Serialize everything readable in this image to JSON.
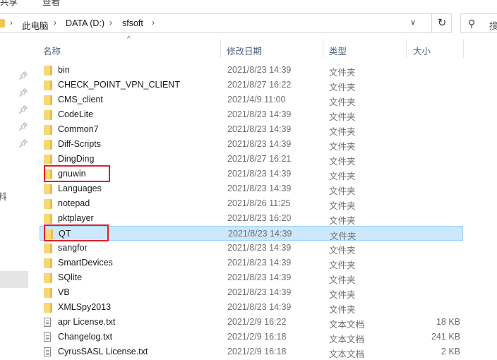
{
  "ribbon": {
    "tabs": [
      "共享",
      "查看"
    ]
  },
  "addressbar": {
    "crumbs": [
      "此电脑",
      "DATA (D:)",
      "sfsoft"
    ],
    "search_placeholder": "搜"
  },
  "nav": {
    "partial_label": "料"
  },
  "columns": {
    "name": "名称",
    "modified": "修改日期",
    "type": "类型",
    "size": "大小"
  },
  "files": [
    {
      "name": "bin",
      "modified": "2021/8/23 14:39",
      "type": "文件夹",
      "size": "",
      "icon": "folder-icon"
    },
    {
      "name": "CHECK_POINT_VPN_CLIENT",
      "modified": "2021/8/27 16:22",
      "type": "文件夹",
      "size": "",
      "icon": "folder-icon"
    },
    {
      "name": "CMS_client",
      "modified": "2021/4/9 11:00",
      "type": "文件夹",
      "size": "",
      "icon": "folder-icon"
    },
    {
      "name": "CodeLite",
      "modified": "2021/8/23 14:39",
      "type": "文件夹",
      "size": "",
      "icon": "folder-icon"
    },
    {
      "name": "Common7",
      "modified": "2021/8/23 14:39",
      "type": "文件夹",
      "size": "",
      "icon": "folder-icon"
    },
    {
      "name": "Diff-Scripts",
      "modified": "2021/8/23 14:39",
      "type": "文件夹",
      "size": "",
      "icon": "folder-icon"
    },
    {
      "name": "DingDing",
      "modified": "2021/8/27 16:21",
      "type": "文件夹",
      "size": "",
      "icon": "folder-icon"
    },
    {
      "name": "gnuwin",
      "modified": "2021/8/23 14:39",
      "type": "文件夹",
      "size": "",
      "icon": "folder-icon",
      "highlight": true
    },
    {
      "name": "Languages",
      "modified": "2021/8/23 14:39",
      "type": "文件夹",
      "size": "",
      "icon": "folder-icon"
    },
    {
      "name": "notepad",
      "modified": "2021/8/26 11:25",
      "type": "文件夹",
      "size": "",
      "icon": "folder-icon"
    },
    {
      "name": "pktplayer",
      "modified": "2021/8/23 16:20",
      "type": "文件夹",
      "size": "",
      "icon": "folder-icon"
    },
    {
      "name": "QT",
      "modified": "2021/8/23 14:39",
      "type": "文件夹",
      "size": "",
      "icon": "folder-icon",
      "selected": true,
      "highlight": true
    },
    {
      "name": "sangfor",
      "modified": "2021/8/23 14:39",
      "type": "文件夹",
      "size": "",
      "icon": "folder-icon"
    },
    {
      "name": "SmartDevices",
      "modified": "2021/8/23 14:39",
      "type": "文件夹",
      "size": "",
      "icon": "folder-icon"
    },
    {
      "name": "SQlite",
      "modified": "2021/8/23 14:39",
      "type": "文件夹",
      "size": "",
      "icon": "folder-icon"
    },
    {
      "name": "VB",
      "modified": "2021/8/23 14:39",
      "type": "文件夹",
      "size": "",
      "icon": "folder-icon"
    },
    {
      "name": "XMLSpy2013",
      "modified": "2021/8/23 14:39",
      "type": "文件夹",
      "size": "",
      "icon": "folder-icon"
    },
    {
      "name": "apr License.txt",
      "modified": "2021/2/9 16:22",
      "type": "文本文档",
      "size": "18 KB",
      "icon": "text-file-icon"
    },
    {
      "name": "Changelog.txt",
      "modified": "2021/2/9 16:18",
      "type": "文本文档",
      "size": "241 KB",
      "icon": "text-file-icon"
    },
    {
      "name": "CyrusSASL License.txt",
      "modified": "2021/2/9 16:18",
      "type": "文本文档",
      "size": "2 KB",
      "icon": "text-file-icon"
    }
  ],
  "colors": {
    "selection_bg": "#cce8ff",
    "highlight_box": "#e0202a",
    "folder": "#f8d775"
  }
}
